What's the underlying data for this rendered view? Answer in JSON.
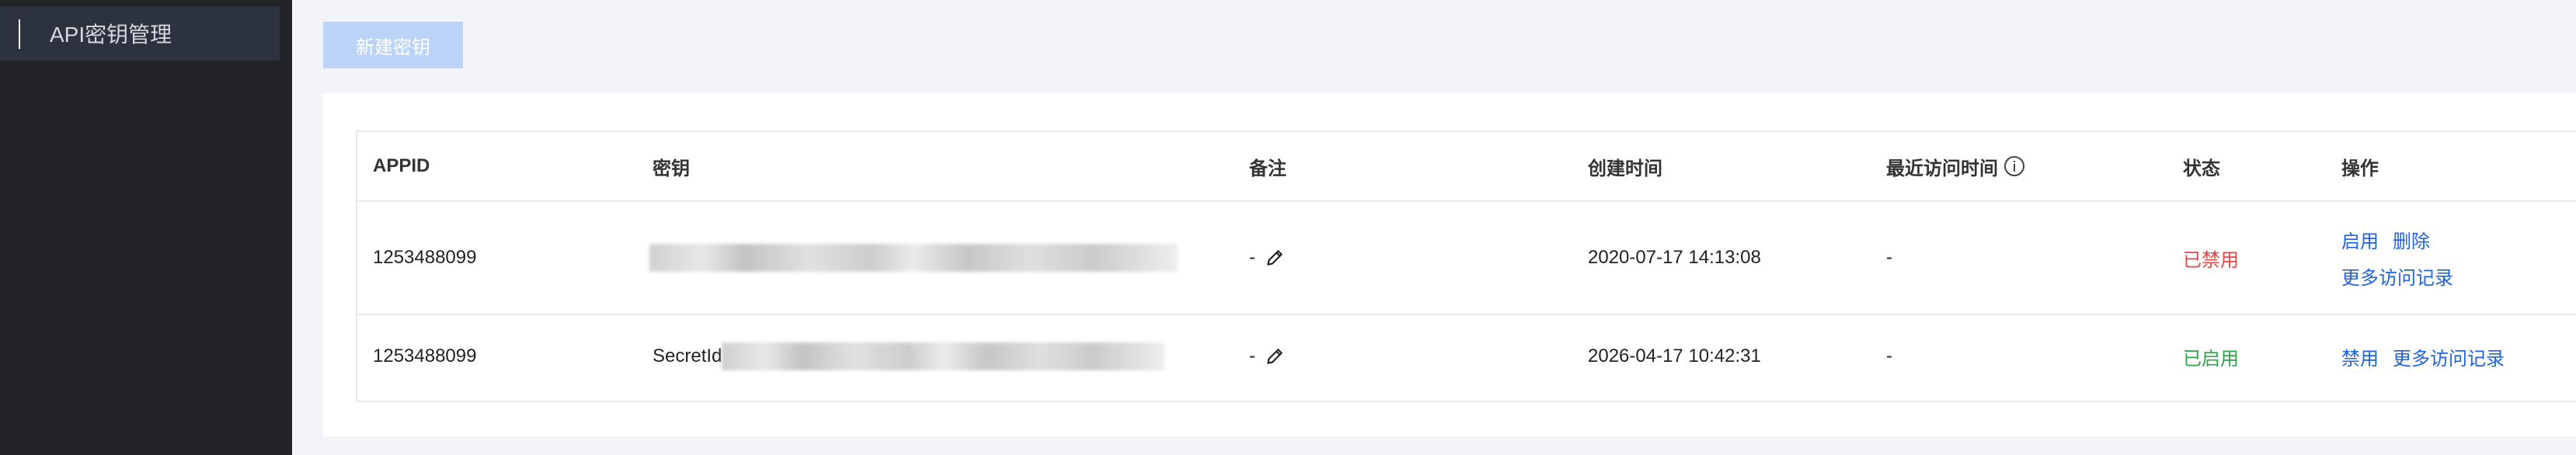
{
  "sidebar": {
    "item_label": "API密钥管理"
  },
  "toolbar": {
    "new_key_label": "新建密钥"
  },
  "table": {
    "headers": {
      "appid": "APPID",
      "key": "密钥",
      "note": "备注",
      "created": "创建时间",
      "last_access": "最近访问时间",
      "status": "状态",
      "ops": "操作"
    },
    "rows": [
      {
        "appid": "1253488099",
        "key_prefix": "",
        "note": "-",
        "created": "2020-07-17 14:13:08",
        "last_access": "-",
        "status": "已禁用",
        "status_color": "#e54545",
        "ops": [
          "启用",
          "删除",
          "更多访问记录"
        ]
      },
      {
        "appid": "1253488099",
        "key_prefix": "SecretId",
        "note": "-",
        "created": "2026-04-17 10:42:31",
        "last_access": "-",
        "status": "已启用",
        "status_color": "#2fa24a",
        "ops": [
          "禁用",
          "更多访问记录"
        ]
      }
    ]
  },
  "colors": {
    "accent": "#1f63e0",
    "button_disabled": "#bcd3f8"
  },
  "icons": {
    "edit": "pencil-icon",
    "info": "info-icon"
  }
}
